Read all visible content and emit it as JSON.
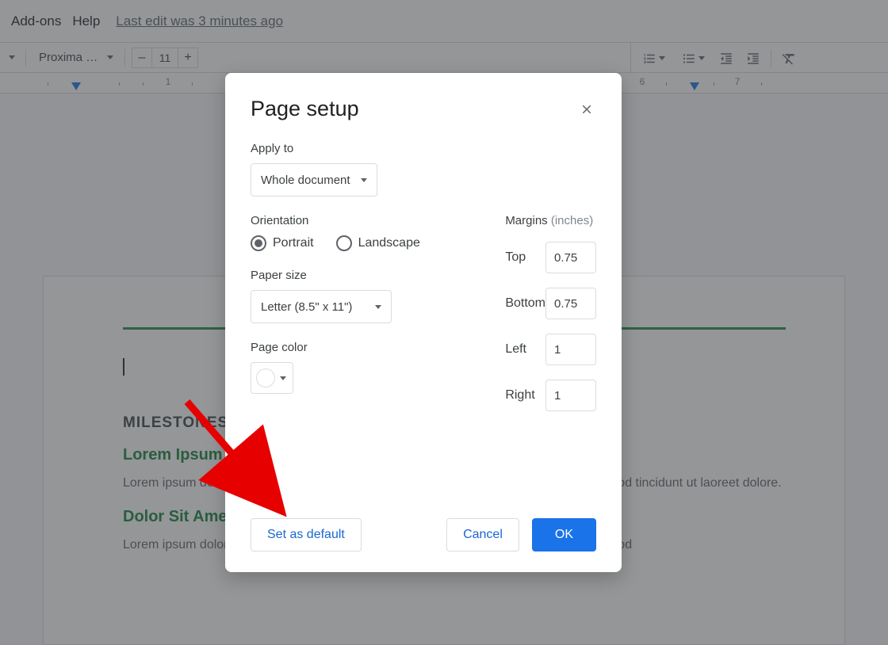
{
  "menu": {
    "addons": "Add-ons",
    "help": "Help",
    "last_edit": "Last edit was 3 minutes ago"
  },
  "toolbar": {
    "font_name": "Proxima N…",
    "font_size": "11",
    "minus": "–",
    "plus": "+"
  },
  "ruler": {
    "labels": {
      "n1": "1",
      "n6": "6",
      "n7": "7"
    }
  },
  "page": {
    "milestones": "MILESTONES",
    "h2a": "Lorem Ipsum",
    "h2b": "Dolor Sit Amet",
    "para1": "Lorem ipsum dolor sit amet, consectetuer adipiscing elit, sed diam nonummy nibh euismod tincidunt ut laoreet dolore.",
    "para2": "Lorem ipsum dolor sit amet, consectetuer adipiscing elit, sed diam nonummy nibh euismod"
  },
  "modal": {
    "title": "Page setup",
    "apply_to": {
      "label": "Apply to",
      "value": "Whole document"
    },
    "orientation": {
      "label": "Orientation",
      "portrait": "Portrait",
      "landscape": "Landscape"
    },
    "paper_size": {
      "label": "Paper size",
      "value": "Letter (8.5\" x 11\")"
    },
    "page_color": {
      "label": "Page color"
    },
    "margins": {
      "label": "Margins",
      "units": "(inches)",
      "top_label": "Top",
      "top_value": "0.75",
      "bottom_label": "Bottom",
      "bottom_value": "0.75",
      "left_label": "Left",
      "left_value": "1",
      "right_label": "Right",
      "right_value": "1"
    },
    "buttons": {
      "set_default": "Set as default",
      "cancel": "Cancel",
      "ok": "OK"
    }
  }
}
